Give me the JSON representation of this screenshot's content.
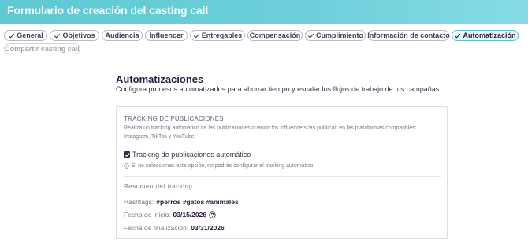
{
  "header": {
    "title": "Formulario de creación del casting call"
  },
  "tabs": [
    {
      "label": "General",
      "checked": true
    },
    {
      "label": "Objetivos",
      "checked": true
    },
    {
      "label": "Audiencia",
      "checked": false
    },
    {
      "label": "Influencer",
      "checked": false
    },
    {
      "label": "Entregables",
      "checked": true
    },
    {
      "label": "Compensación",
      "checked": false
    },
    {
      "label": "Cumplimiento",
      "checked": true
    },
    {
      "label": "Información de contacto",
      "checked": false
    },
    {
      "label": "Automatización",
      "checked": true,
      "active": true
    },
    {
      "label": "Compartir casting call",
      "checked": false,
      "disabled": true
    }
  ],
  "main": {
    "title": "Automatizaciones",
    "subtitle": "Configura procesos automatizados para ahorrar tiempo y escalar los flujos de trabajo de tus campañas."
  },
  "tracking": {
    "section_title": "TRACKING DE PUBLICACIONES",
    "description": "Realiza un tracking automático de las publicaciones cuando los influencers las publican en las plataformas compatibles: Instagram, TikTok y YouTube.",
    "checkbox_label": "Tracking de publicaciones automático",
    "checkbox_checked": true,
    "note": "Si no seleccionas esta opción, no podrás configurar el tracking automático."
  },
  "summary": {
    "title": "Resumen del tracking",
    "hashtags_label": "Hashtags:",
    "hashtags_value": "#perros #gatos #animales",
    "start_label": "Fecha de inicio:",
    "start_value": "03/15/2026",
    "end_label": "Fecha de finalización:",
    "end_value": "03/31/2026"
  },
  "colors": {
    "header_gradient_start": "#5ec9d2",
    "header_gradient_end": "#86dbe6",
    "active_tab_border": "#5bc3cf",
    "checkbox": "#3a2752"
  },
  "icons": {
    "tab_check": "check-icon",
    "note": "info-circle-icon",
    "start_help": "question-circle-icon"
  }
}
